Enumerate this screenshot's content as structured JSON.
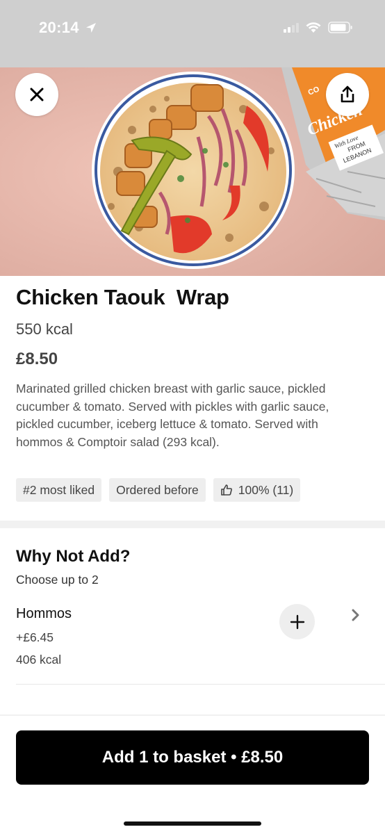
{
  "status_bar": {
    "time": "20:14"
  },
  "item": {
    "title": "Chicken Taouk  Wrap",
    "kcal": "550 kcal",
    "price": "£8.50",
    "description": "Marinated grilled chicken breast with garlic sauce, pickled cucumber & tomato. Served with pickles with garlic sauce, pickled cucumber, iceberg lettuce & tomato. Served with hommos & Comptoir salad (293 kcal).",
    "badges": [
      {
        "label": "#2 most liked"
      },
      {
        "label": "Ordered before"
      },
      {
        "label": "100% (11)",
        "icon": "thumbs-up-icon"
      }
    ]
  },
  "hero": {
    "wrap_label_line1": "CO",
    "wrap_label_line2": "Chicken",
    "wrap_label_line3": "With Love",
    "wrap_label_line4": "FROM",
    "wrap_label_line5": "LEBANON"
  },
  "addons": {
    "title": "Why Not Add?",
    "subtitle": "Choose up to 2",
    "options": [
      {
        "name": "Hommos",
        "price": "+£6.45",
        "kcal": "406 kcal"
      }
    ]
  },
  "basket_button": {
    "label": "Add 1 to basket • £8.50"
  },
  "colors": {
    "accent": "#000000",
    "badge_bg": "#eeeeee",
    "hero_bg": "#e8b9ae",
    "wrap_orange": "#f08a2a"
  },
  "icons": {
    "close": "close-icon",
    "share": "share-icon",
    "add": "plus-icon",
    "chevron": "chevron-right-icon",
    "location": "location-arrow-icon"
  }
}
